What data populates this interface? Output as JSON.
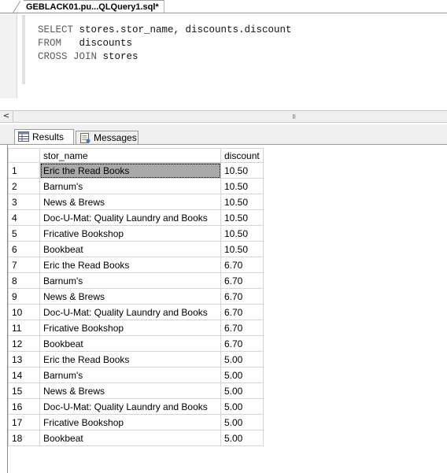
{
  "document_tab": {
    "title": "GEBLACK01.pu...QLQuery1.sql*"
  },
  "editor": {
    "lines": [
      [
        {
          "kw": "SELECT"
        },
        {
          "t": " stores.stor_name, discounts.discount"
        }
      ],
      [
        {
          "kw": "FROM"
        },
        {
          "t": "   discounts"
        }
      ],
      [
        {
          "kw": "CROSS JOIN"
        },
        {
          "t": " stores"
        }
      ]
    ]
  },
  "scrollbar": {
    "left_arrow": "<",
    "grip": "III"
  },
  "results_tabs": [
    {
      "label": "Results",
      "icon": "grid-icon",
      "active": true
    },
    {
      "label": "Messages",
      "icon": "messages-icon",
      "active": false
    }
  ],
  "grid": {
    "columns": [
      "",
      "stor_name",
      "discount"
    ],
    "rows": [
      [
        "1",
        "Eric the Read Books",
        "10.50"
      ],
      [
        "2",
        "Barnum's",
        "10.50"
      ],
      [
        "3",
        "News & Brews",
        "10.50"
      ],
      [
        "4",
        "Doc-U-Mat: Quality Laundry and Books",
        "10.50"
      ],
      [
        "5",
        "Fricative Bookshop",
        "10.50"
      ],
      [
        "6",
        "Bookbeat",
        "10.50"
      ],
      [
        "7",
        "Eric the Read Books",
        "6.70"
      ],
      [
        "8",
        "Barnum's",
        "6.70"
      ],
      [
        "9",
        "News & Brews",
        "6.70"
      ],
      [
        "10",
        "Doc-U-Mat: Quality Laundry and Books",
        "6.70"
      ],
      [
        "11",
        "Fricative Bookshop",
        "6.70"
      ],
      [
        "12",
        "Bookbeat",
        "6.70"
      ],
      [
        "13",
        "Eric the Read Books",
        "5.00"
      ],
      [
        "14",
        "Barnum's",
        "5.00"
      ],
      [
        "15",
        "News & Brews",
        "5.00"
      ],
      [
        "16",
        "Doc-U-Mat: Quality Laundry and Books",
        "5.00"
      ],
      [
        "17",
        "Fricative Bookshop",
        "5.00"
      ],
      [
        "18",
        "Bookbeat",
        "5.00"
      ]
    ],
    "selected_cell": {
      "row": 0,
      "col": 1
    }
  },
  "colors": {
    "keyword": "#5a5a5a",
    "selection": "#a9a9a9",
    "chrome": "#f0f0f0"
  }
}
